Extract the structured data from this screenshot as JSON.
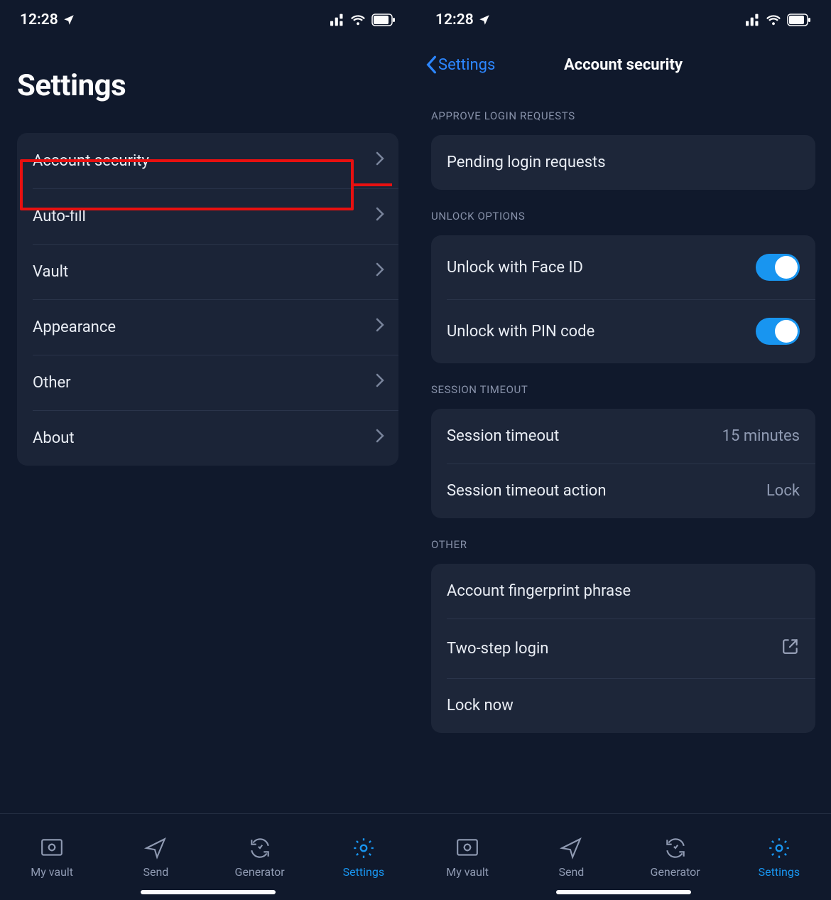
{
  "status": {
    "time": "12:28"
  },
  "left": {
    "title": "Settings",
    "items": [
      {
        "label": "Account security"
      },
      {
        "label": "Auto-fill"
      },
      {
        "label": "Vault"
      },
      {
        "label": "Appearance"
      },
      {
        "label": "Other"
      },
      {
        "label": "About"
      }
    ]
  },
  "right": {
    "back": "Settings",
    "title": "Account security",
    "sections": {
      "approve": {
        "header": "APPROVE LOGIN REQUESTS",
        "pending": "Pending login requests"
      },
      "unlock": {
        "header": "UNLOCK OPTIONS",
        "faceid": "Unlock with Face ID",
        "pin": "Unlock with PIN code"
      },
      "timeout": {
        "header": "SESSION TIMEOUT",
        "timeout_label": "Session timeout",
        "timeout_value": "15 minutes",
        "action_label": "Session timeout action",
        "action_value": "Lock"
      },
      "other": {
        "header": "OTHER",
        "fingerprint": "Account fingerprint phrase",
        "twostep": "Two-step login",
        "locknow": "Lock now"
      }
    }
  },
  "tabs": {
    "vault": "My vault",
    "send": "Send",
    "generator": "Generator",
    "settings": "Settings"
  }
}
